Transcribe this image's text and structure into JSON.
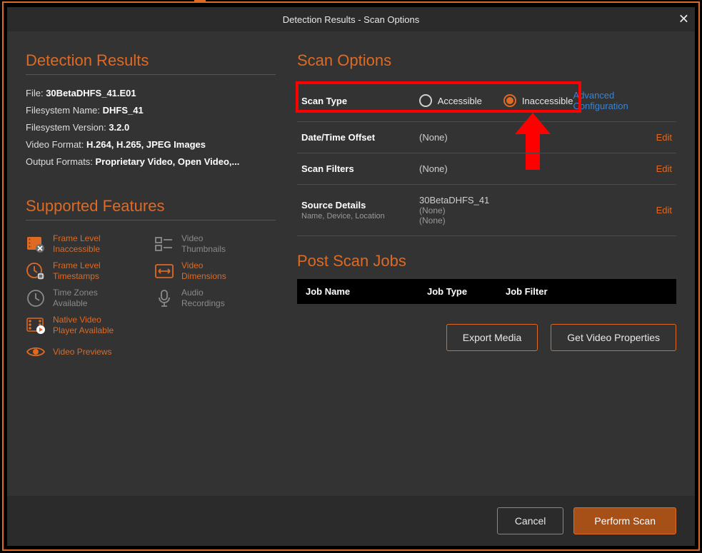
{
  "titlebar": {
    "title": "Detection Results - Scan Options"
  },
  "detection": {
    "heading": "Detection Results",
    "rows": [
      {
        "label": "File:",
        "value": "30BetaDHFS_41.E01"
      },
      {
        "label": "Filesystem Name:",
        "value": "DHFS_41"
      },
      {
        "label": "Filesystem Version:",
        "value": "3.2.0"
      },
      {
        "label": "Video Format:",
        "value": "H.264, H.265, JPEG Images"
      },
      {
        "label": "Output Formats:",
        "value": "Proprietary Video, Open Video,..."
      }
    ]
  },
  "features": {
    "heading": "Supported Features",
    "items": [
      {
        "label": "Frame Level\nInaccessible",
        "icon": "film-x-icon",
        "style": "orange"
      },
      {
        "label": "Video\nThumbnails",
        "icon": "thumbnails-icon",
        "style": "grey"
      },
      {
        "label": "Frame Level\nTimestamps",
        "icon": "clock-badge-icon",
        "style": "orange"
      },
      {
        "label": "Video\nDimensions",
        "icon": "dimensions-icon",
        "style": "orange"
      },
      {
        "label": "Time Zones\nAvailable",
        "icon": "clock-icon",
        "style": "grey"
      },
      {
        "label": "Audio\nRecordings",
        "icon": "microphone-icon",
        "style": "grey"
      },
      {
        "label": "Native Video\nPlayer Available",
        "icon": "film-play-icon",
        "style": "orange"
      },
      {
        "label": "",
        "icon": "",
        "style": ""
      },
      {
        "label": "Video Previews",
        "icon": "eye-icon",
        "style": "orange"
      }
    ]
  },
  "scan": {
    "heading": "Scan Options",
    "type_label": "Scan Type",
    "radio_accessible": "Accessible",
    "radio_inaccessible": "Inaccessible",
    "selected": "inaccessible",
    "advanced_link": "Advanced Configuration",
    "rows": [
      {
        "label": "Date/Time Offset",
        "sublabel": "",
        "value": "(None)",
        "subvalue": "",
        "edit": "Edit"
      },
      {
        "label": "Scan Filters",
        "sublabel": "",
        "value": "(None)",
        "subvalue": "",
        "edit": "Edit"
      },
      {
        "label": "Source Details",
        "sublabel": "Name, Device, Location",
        "value": "30BetaDHFS_41",
        "subvalue": "(None)\n(None)",
        "edit": "Edit"
      }
    ]
  },
  "post": {
    "heading": "Post Scan Jobs",
    "cols": {
      "c1": "Job Name",
      "c2": "Job Type",
      "c3": "Job Filter"
    },
    "export_btn": "Export Media",
    "props_btn": "Get Video Properties"
  },
  "footer": {
    "cancel": "Cancel",
    "perform": "Perform Scan"
  }
}
